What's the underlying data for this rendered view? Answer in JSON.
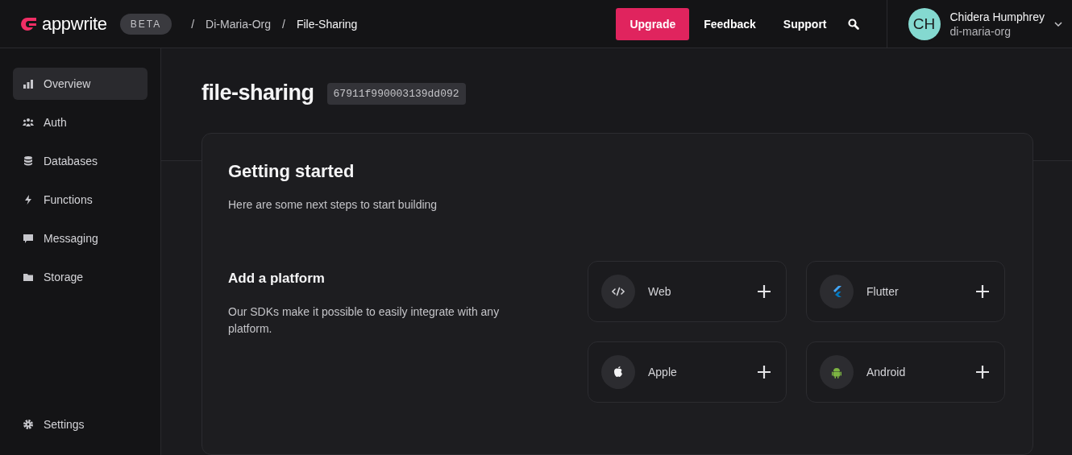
{
  "header": {
    "logo": "appwrite",
    "badge": "BETA",
    "breadcrumbs": [
      "Di-Maria-Org",
      "File-Sharing"
    ],
    "separator": "/",
    "upgrade": "Upgrade",
    "links": [
      "Feedback",
      "Support"
    ],
    "user": {
      "initials": "CH",
      "name": "Chidera Humphrey",
      "org": "di-maria-org"
    }
  },
  "sidebar": {
    "items": [
      {
        "kind": "overview",
        "label": "Overview",
        "selected": true
      },
      {
        "kind": "auth",
        "label": "Auth",
        "selected": false
      },
      {
        "kind": "databases",
        "label": "Databases",
        "selected": false
      },
      {
        "kind": "functions",
        "label": "Functions",
        "selected": false
      },
      {
        "kind": "messaging",
        "label": "Messaging",
        "selected": false
      },
      {
        "kind": "storage",
        "label": "Storage",
        "selected": false
      }
    ],
    "bottom": {
      "kind": "settings",
      "label": "Settings",
      "selected": false
    }
  },
  "project": {
    "name": "file-sharing",
    "id": "67911f990003139dd092"
  },
  "getting_started": {
    "title": "Getting started",
    "subtitle": "Here are some next steps to start building",
    "section_title": "Add a platform",
    "section_text": "Our SDKs make it possible to easily integrate with any platform.",
    "platforms": [
      {
        "kind": "web",
        "label": "Web"
      },
      {
        "kind": "flutter",
        "label": "Flutter"
      },
      {
        "kind": "apple",
        "label": "Apple"
      },
      {
        "kind": "android",
        "label": "Android"
      }
    ]
  }
}
